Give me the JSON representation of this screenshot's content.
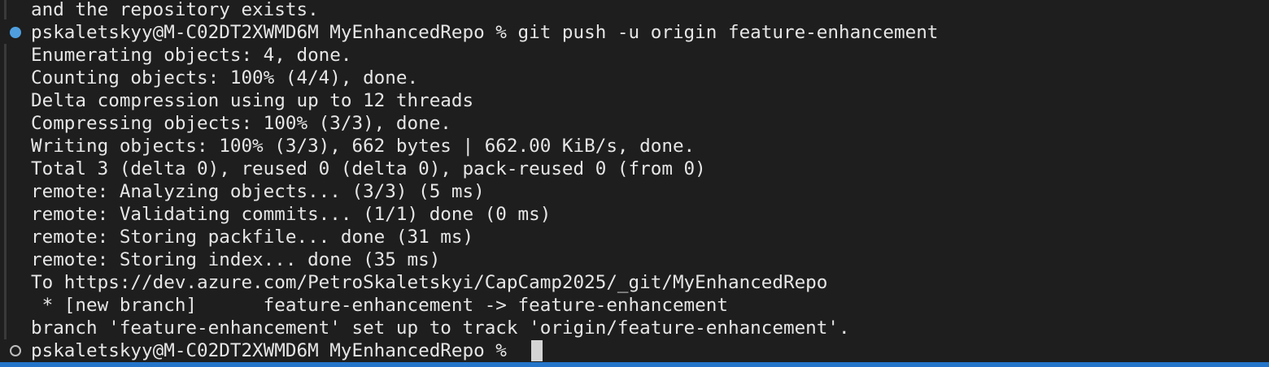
{
  "terminal": {
    "lines": [
      "and the repository exists.",
      "pskaletskyy@M-C02DT2XWMD6M MyEnhancedRepo % git push -u origin feature-enhancement",
      "Enumerating objects: 4, done.",
      "Counting objects: 100% (4/4), done.",
      "Delta compression using up to 12 threads",
      "Compressing objects: 100% (3/3), done.",
      "Writing objects: 100% (3/3), 662 bytes | 662.00 KiB/s, done.",
      "Total 3 (delta 0), reused 0 (delta 0), pack-reused 0 (from 0)",
      "remote: Analyzing objects... (3/3) (5 ms)",
      "remote: Validating commits... (1/1) done (0 ms)",
      "remote: Storing packfile... done (31 ms)",
      "remote: Storing index... done (35 ms)",
      "To https://dev.azure.com/PetroSkaletskyi/CapCamp2025/_git/MyEnhancedRepo",
      " * [new branch]      feature-enhancement -> feature-enhancement",
      "branch 'feature-enhancement' set up to track 'origin/feature-enhancement'."
    ],
    "prompt": "pskaletskyy@M-C02DT2XWMD6M MyEnhancedRepo % ",
    "colors": {
      "background": "#1e1e1e",
      "text": "#e6e6e6",
      "command_marker": "#4f9fe0",
      "status_strip": "#2475c9"
    },
    "icons": {
      "completed_command": "filled-circle",
      "active_command": "hollow-circle",
      "cursor": "block-cursor"
    }
  }
}
